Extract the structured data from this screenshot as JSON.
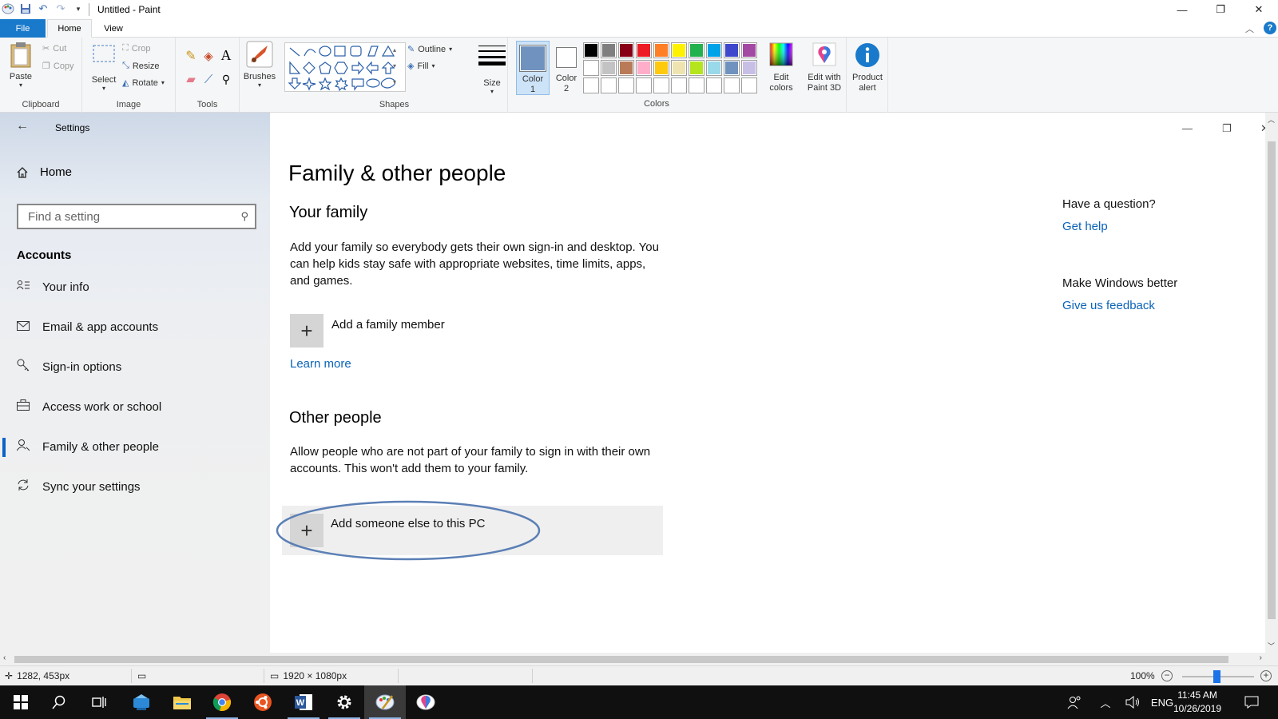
{
  "window": {
    "title": "Untitled - Paint"
  },
  "ribbon": {
    "tabs": [
      "File",
      "Home",
      "View"
    ],
    "clipboard": {
      "paste": "Paste",
      "cut": "Cut",
      "copy": "Copy",
      "group": "Clipboard"
    },
    "image": {
      "select": "Select",
      "crop": "Crop",
      "resize": "Resize",
      "rotate": "Rotate",
      "group": "Image"
    },
    "tools": {
      "group": "Tools"
    },
    "brushes": {
      "label": "Brushes"
    },
    "shapes": {
      "outline": "Outline",
      "fill": "Fill",
      "group": "Shapes"
    },
    "size": {
      "label": "Size"
    },
    "color1": {
      "line1": "Color",
      "line2": "1"
    },
    "color2": {
      "line1": "Color",
      "line2": "2"
    },
    "colors_group": "Colors",
    "edit_colors": {
      "line1": "Edit",
      "line2": "colors"
    },
    "paint3d": {
      "line1": "Edit with",
      "line2": "Paint 3D"
    },
    "product_alert": {
      "line1": "Product",
      "line2": "alert"
    },
    "palette_row1": [
      "#000000",
      "#7f7f7f",
      "#880015",
      "#ed1c24",
      "#ff7f27",
      "#fff200",
      "#22b14c",
      "#00a2e8",
      "#3f48cc",
      "#a349a4"
    ],
    "palette_row2": [
      "#ffffff",
      "#c3c3c3",
      "#b97a57",
      "#ffaec9",
      "#ffc90e",
      "#efe4b0",
      "#b5e61d",
      "#99d9ea",
      "#7092be",
      "#c8bfe7"
    ],
    "color1_value": "#7092be",
    "color2_value": "#ffffff"
  },
  "settings": {
    "window_title": "Settings",
    "home": "Home",
    "search_placeholder": "Find a setting",
    "section": "Accounts",
    "nav": [
      {
        "label": "Your info",
        "icon": "person-card-icon"
      },
      {
        "label": "Email & app accounts",
        "icon": "mail-icon"
      },
      {
        "label": "Sign-in options",
        "icon": "key-icon"
      },
      {
        "label": "Access work or school",
        "icon": "briefcase-icon"
      },
      {
        "label": "Family & other people",
        "icon": "person-add-icon",
        "selected": true
      },
      {
        "label": "Sync your settings",
        "icon": "sync-icon"
      }
    ],
    "page_title": "Family & other people",
    "family": {
      "heading": "Your family",
      "description": "Add your family so everybody gets their own sign-in and desktop. You can help kids stay safe with appropriate websites, time limits, apps, and games.",
      "add_label": "Add a family member",
      "learn_more": "Learn more"
    },
    "other": {
      "heading": "Other people",
      "description": "Allow people who are not part of your family to sign in with their own accounts. This won't add them to your family.",
      "add_label": "Add someone else to this PC"
    },
    "aside": {
      "question": "Have a question?",
      "get_help": "Get help",
      "better": "Make Windows better",
      "feedback": "Give us feedback"
    },
    "annotation_color": "#5b7fb5"
  },
  "status": {
    "cursor": "1282, 453px",
    "canvas_size": "1920 × 1080px",
    "zoom": "100%",
    "zoom_level_percent": 100
  },
  "taskbar": {
    "apps": [
      "start-icon",
      "search-icon",
      "task-view-icon",
      "app-icon",
      "file-explorer-icon",
      "chrome-icon",
      "ubuntu-icon",
      "word-icon",
      "settings-icon",
      "paint-icon",
      "paint3d-icon"
    ],
    "language": "ENG",
    "time": "11:45 AM",
    "date": "10/26/2019"
  }
}
